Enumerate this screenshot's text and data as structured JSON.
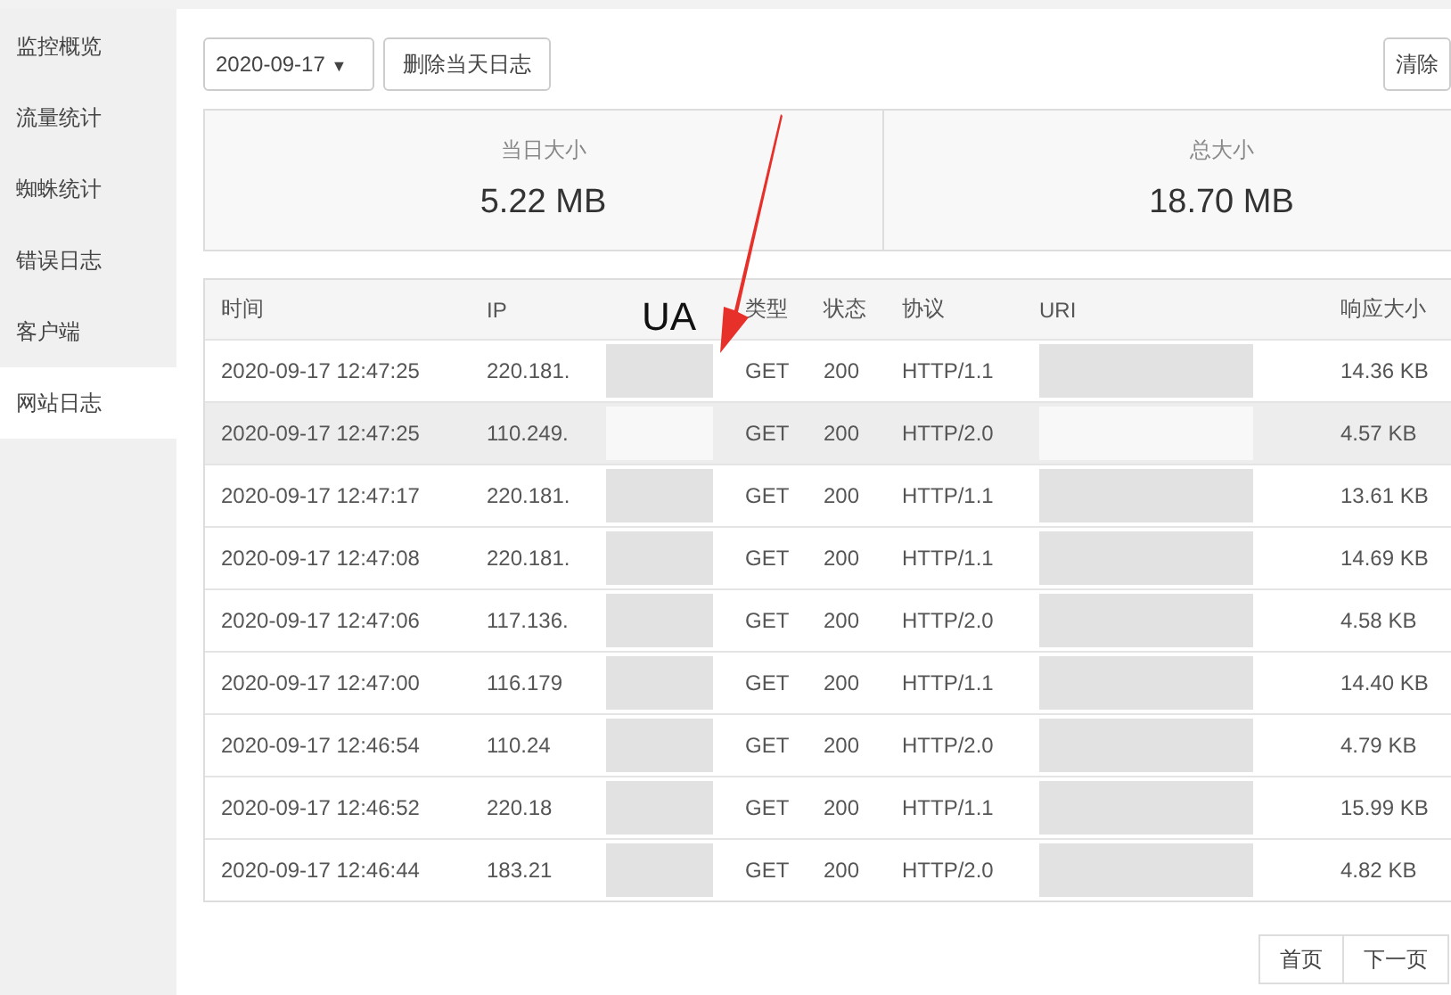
{
  "sidebar": {
    "items": [
      {
        "label": "监控概览",
        "selected": false
      },
      {
        "label": "流量统计",
        "selected": false
      },
      {
        "label": "蜘蛛统计",
        "selected": false
      },
      {
        "label": "错误日志",
        "selected": false
      },
      {
        "label": "客户端",
        "selected": false
      },
      {
        "label": "网站日志",
        "selected": true
      }
    ]
  },
  "toolbar": {
    "date_select": {
      "value": "2020-09-17",
      "caret": "▼"
    },
    "delete_button": "删除当天日志",
    "clear_button": "清除"
  },
  "stats": [
    {
      "label": "当日大小",
      "value": "5.22 MB"
    },
    {
      "label": "总大小",
      "value": "18.70 MB"
    }
  ],
  "table": {
    "columns": [
      "时间",
      "IP",
      "UA",
      "类型",
      "状态",
      "协议",
      "URI",
      "响应大小"
    ],
    "rows": [
      {
        "time": "2020-09-17 12:47:25",
        "ip": "220.181.",
        "type": "GET",
        "status": "200",
        "protocol": "HTTP/1.1",
        "size": "14.36 KB",
        "highlighted": false
      },
      {
        "time": "2020-09-17 12:47:25",
        "ip": "110.249.",
        "type": "GET",
        "status": "200",
        "protocol": "HTTP/2.0",
        "size": "4.57 KB",
        "highlighted": true
      },
      {
        "time": "2020-09-17 12:47:17",
        "ip": "220.181.",
        "type": "GET",
        "status": "200",
        "protocol": "HTTP/1.1",
        "size": "13.61 KB",
        "highlighted": false
      },
      {
        "time": "2020-09-17 12:47:08",
        "ip": "220.181.",
        "type": "GET",
        "status": "200",
        "protocol": "HTTP/1.1",
        "size": "14.69 KB",
        "highlighted": false
      },
      {
        "time": "2020-09-17 12:47:06",
        "ip": "117.136.",
        "type": "GET",
        "status": "200",
        "protocol": "HTTP/2.0",
        "size": "4.58 KB",
        "highlighted": false
      },
      {
        "time": "2020-09-17 12:47:00",
        "ip": "116.179",
        "type": "GET",
        "status": "200",
        "protocol": "HTTP/1.1",
        "size": "14.40 KB",
        "highlighted": false
      },
      {
        "time": "2020-09-17 12:46:54",
        "ip": "110.24",
        "type": "GET",
        "status": "200",
        "protocol": "HTTP/2.0",
        "size": "4.79 KB",
        "highlighted": false
      },
      {
        "time": "2020-09-17 12:46:52",
        "ip": "220.18",
        "type": "GET",
        "status": "200",
        "protocol": "HTTP/1.1",
        "size": "15.99 KB",
        "highlighted": false
      },
      {
        "time": "2020-09-17 12:46:44",
        "ip": "183.21",
        "type": "GET",
        "status": "200",
        "protocol": "HTTP/2.0",
        "size": "4.82 KB",
        "highlighted": false
      }
    ]
  },
  "pagination": [
    "首页",
    "下一页"
  ]
}
